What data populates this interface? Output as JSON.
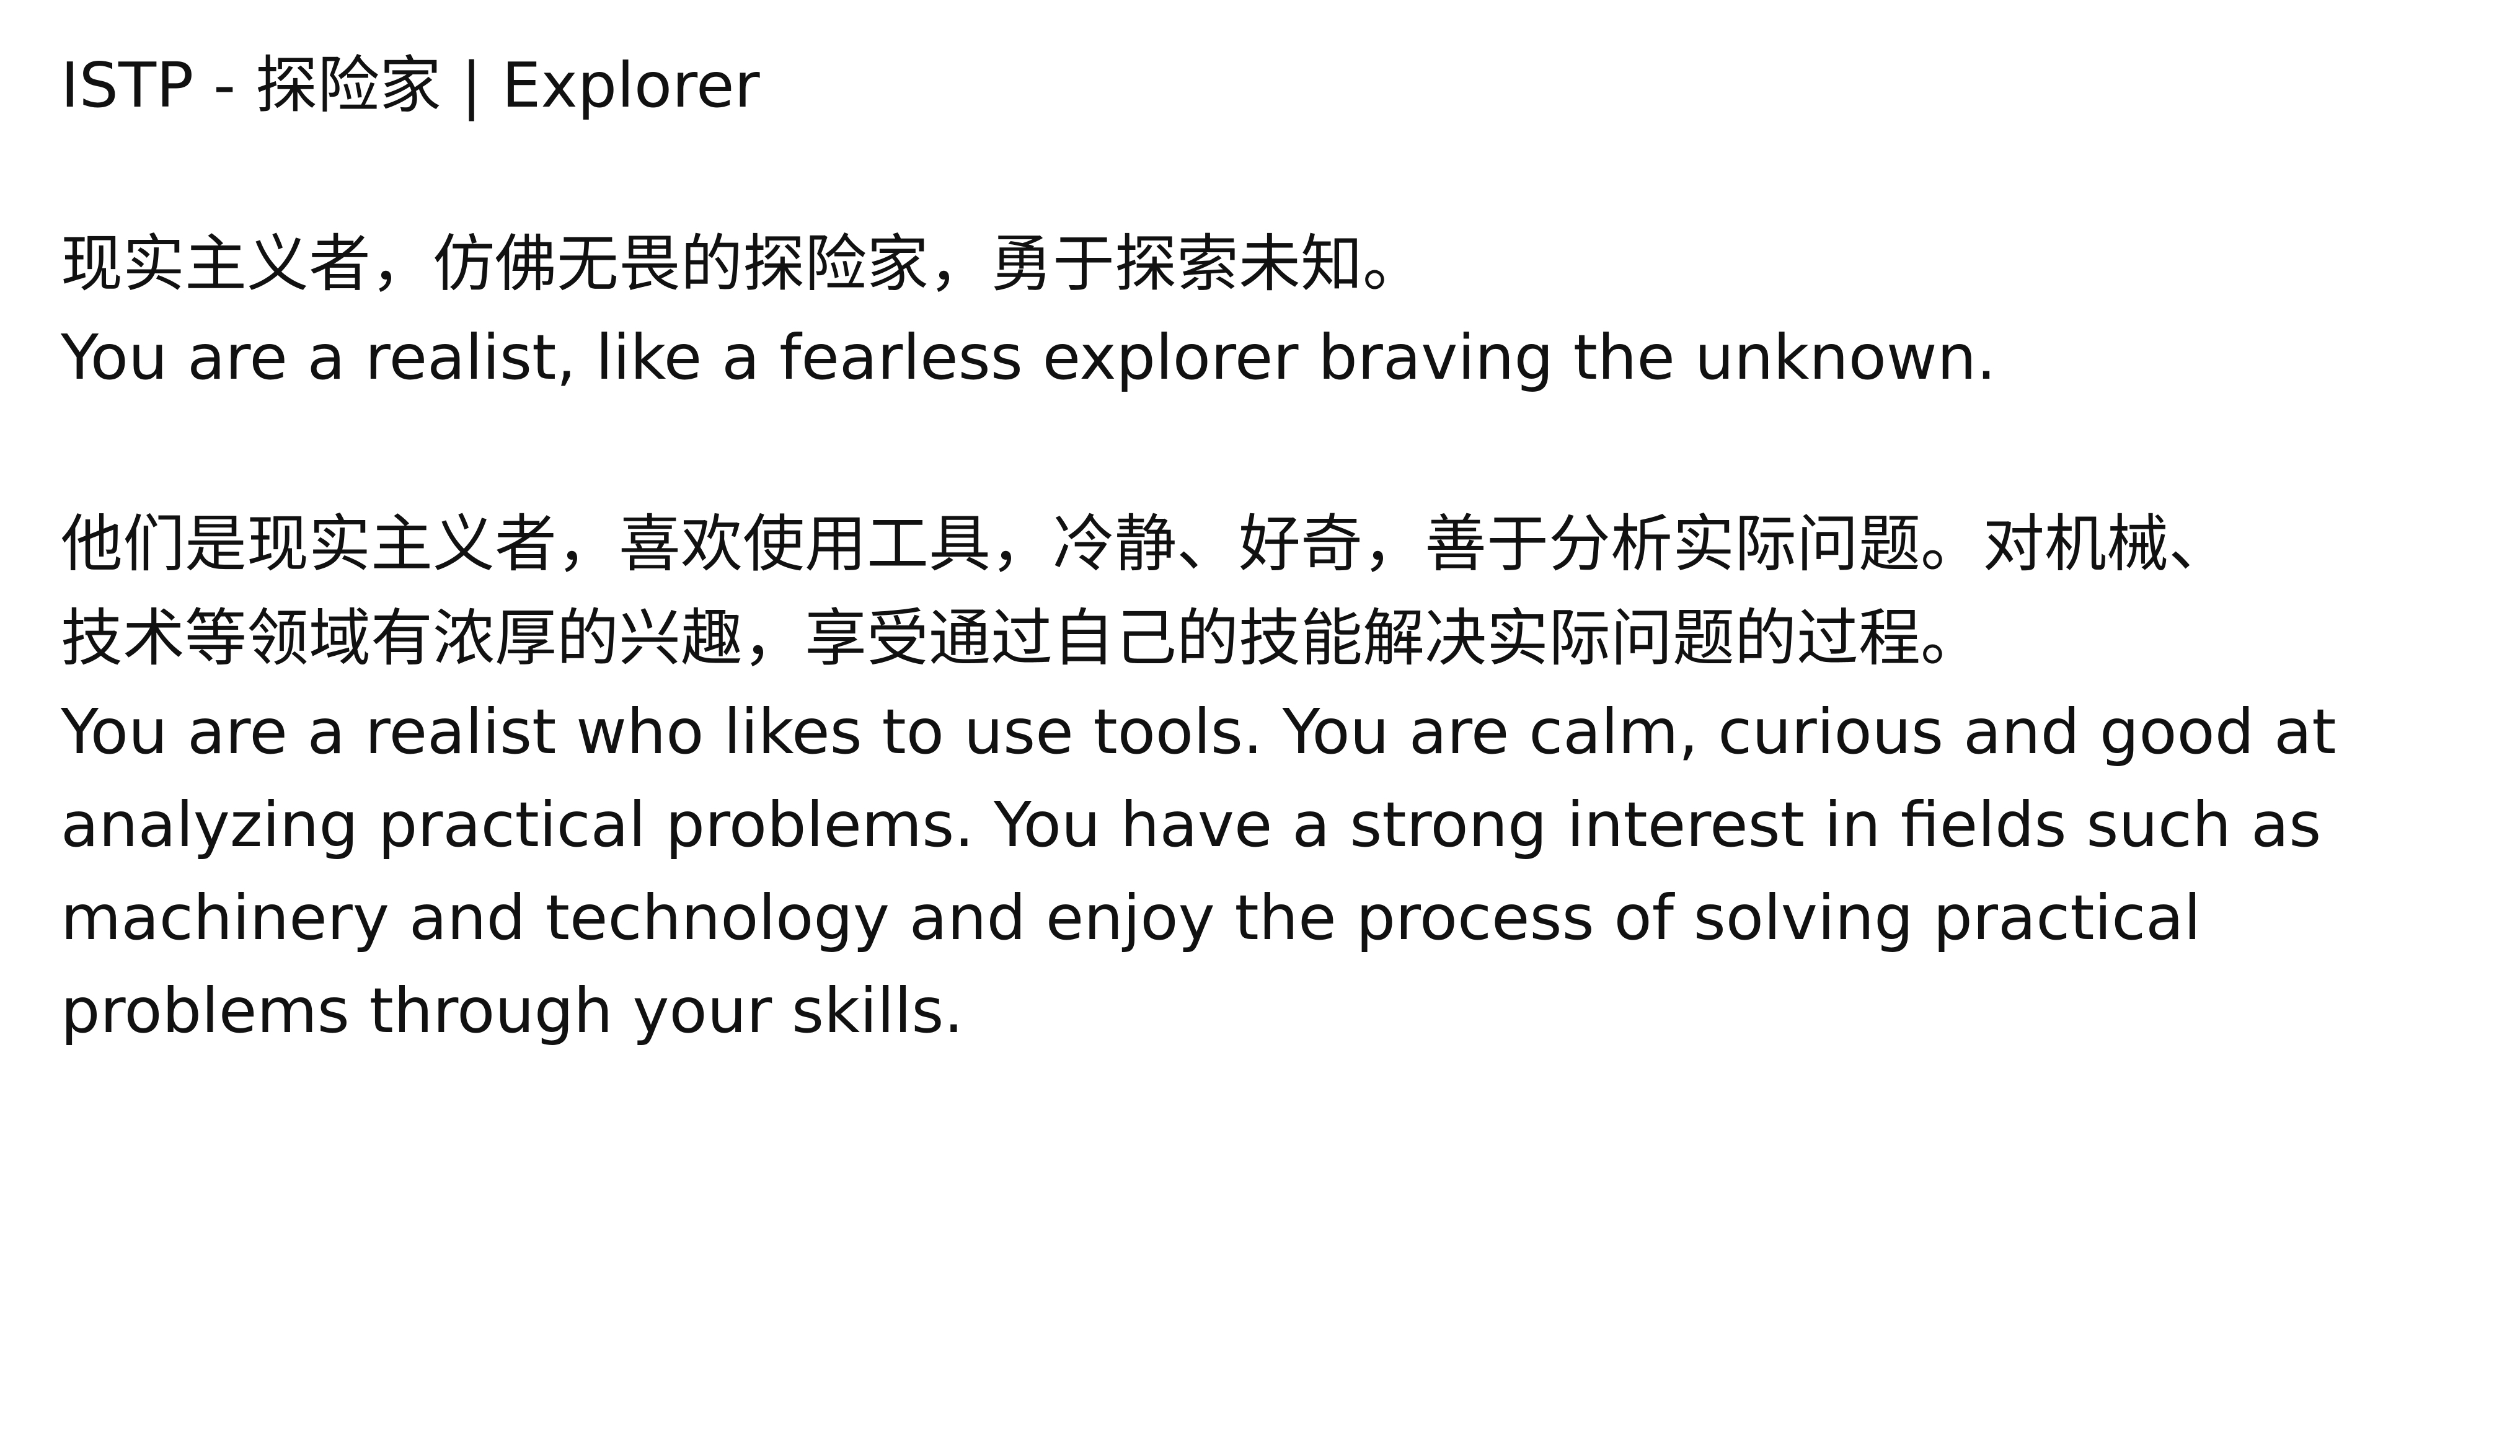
{
  "document": {
    "title": "ISTP - 探险家 | Explorer",
    "intro": {
      "cn": "现实主义者，仿佛无畏的探险家，勇于探索未知。",
      "en": "You are a realist, like a fearless explorer braving the unknown."
    },
    "description": {
      "cn_lines": [
        "他们是现实主义者，喜欢使用工具，冷静、好奇，善于分析实际问题。对机械、",
        "技术等领域有浓厚的兴趣，享受通过自己的技能解决实际问题的过程。"
      ],
      "en_lines": [
        "You are a realist who likes to use tools. You are calm, curious and good at",
        "analyzing practical problems. You have a strong interest in fields such as",
        "machinery and technology and enjoy the process of solving practical",
        "problems through your skills."
      ]
    }
  }
}
